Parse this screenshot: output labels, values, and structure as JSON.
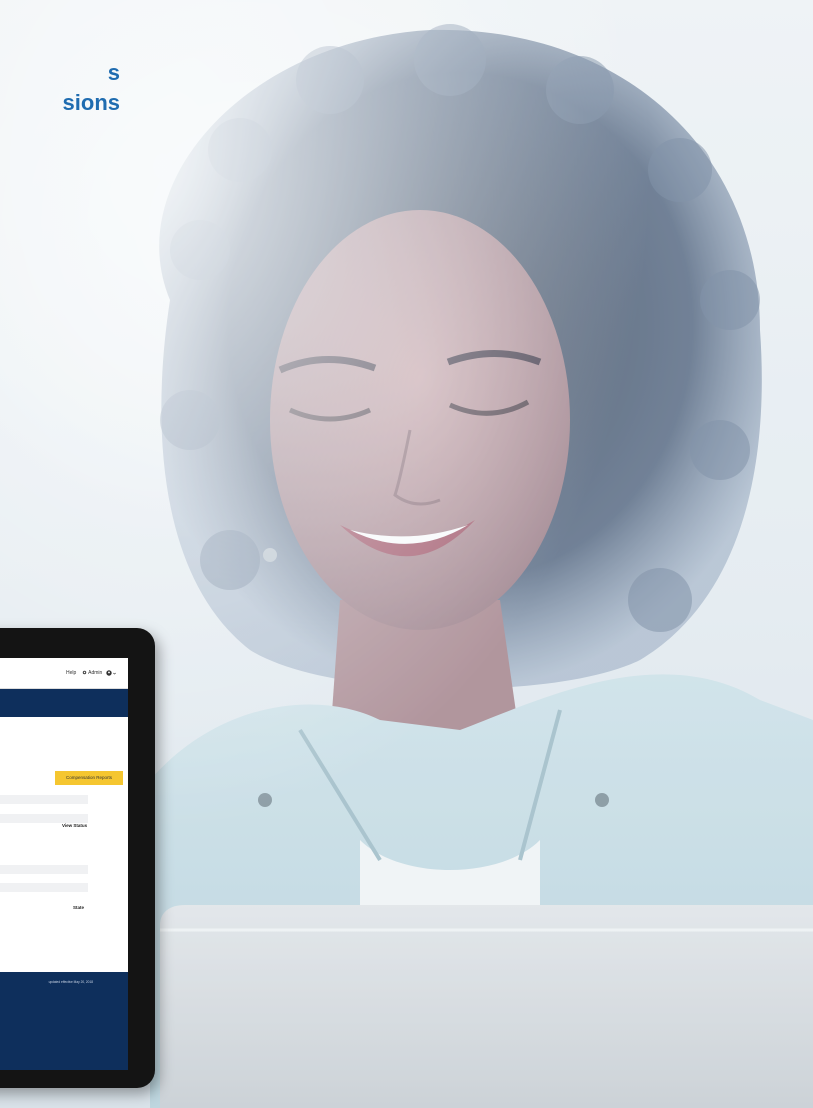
{
  "headline": {
    "line1": "s",
    "line2": "sions",
    "color": "#1f6cb0"
  },
  "tablet": {
    "topbar": {
      "help_label": "Help",
      "admin_label": "Admin",
      "user_label": "",
      "admin_icon": "gear-icon",
      "user_icon": "user-circle-icon"
    },
    "nav_color": "#0e2f5c",
    "compensation_button_label": "Compensation Reports",
    "compensation_button_color": "#f5c630",
    "view_status_label": "View Status",
    "state_label": "State",
    "footer_text": "updated effective May 20, 2018"
  }
}
